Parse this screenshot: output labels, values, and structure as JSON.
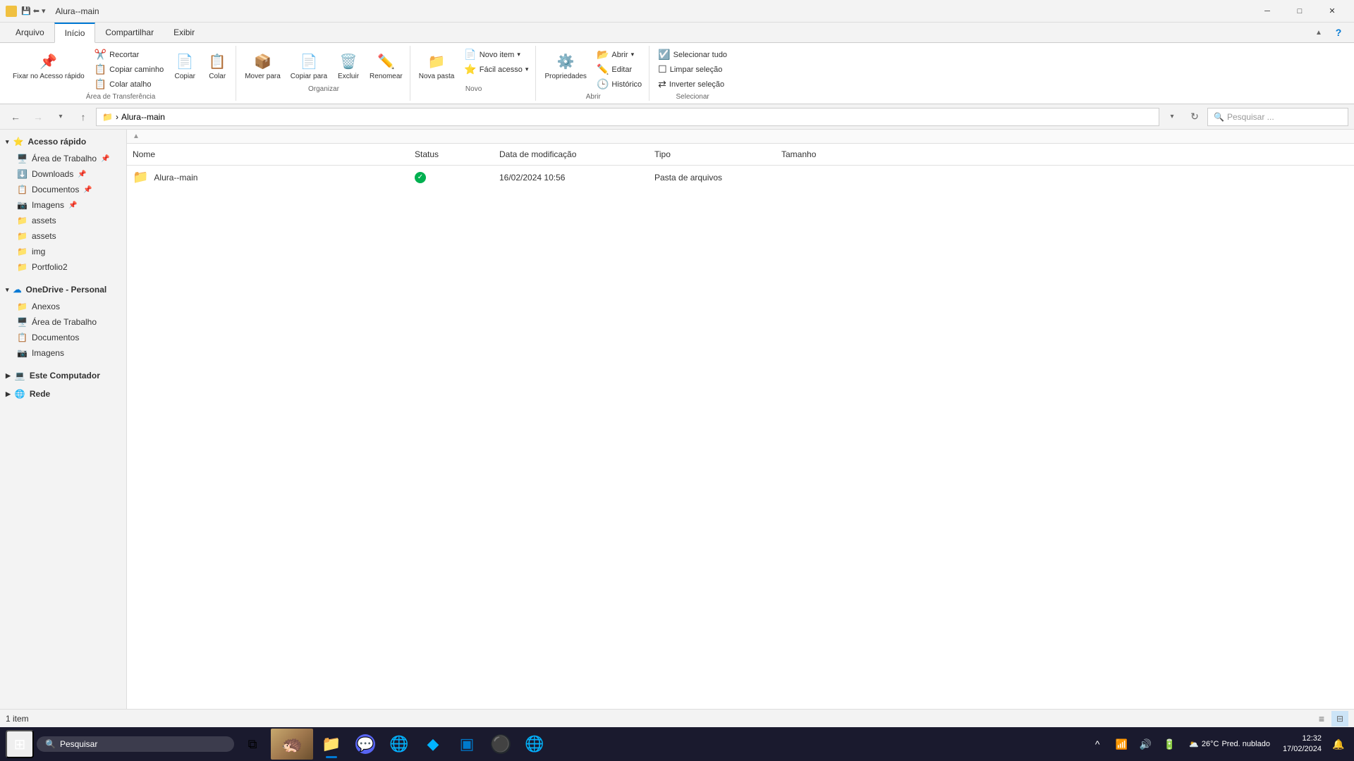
{
  "window": {
    "title": "Alura--main",
    "icon": "folder"
  },
  "title_bar": {
    "title": "Alura--main",
    "minimize_label": "─",
    "maximize_label": "□",
    "close_label": "✕"
  },
  "ribbon": {
    "tabs": [
      "Arquivo",
      "Início",
      "Compartilhar",
      "Exibir"
    ],
    "active_tab": "Início",
    "groups": {
      "area_transferencia": {
        "label": "Área de Transferência",
        "buttons": {
          "fixar": "Fixar no\nAcesso rápido",
          "copiar": "Copiar",
          "colar": "Colar",
          "recortar": "Recortar",
          "copiar_caminho": "Copiar caminho",
          "colar_atalho": "Colar atalho"
        }
      },
      "organizar": {
        "label": "Organizar",
        "buttons": {
          "mover": "Mover\npara",
          "copiar": "Copiar\npara",
          "excluir": "Excluir",
          "renomear": "Renomear"
        }
      },
      "novo": {
        "label": "Novo",
        "buttons": {
          "nova_pasta": "Nova\npasta",
          "novo_item": "Novo item",
          "facil_acesso": "Fácil acesso"
        }
      },
      "abrir": {
        "label": "Abrir",
        "buttons": {
          "abrir": "Abrir",
          "editar": "Editar",
          "historico": "Histórico",
          "propriedades": "Propriedades"
        }
      },
      "selecionar": {
        "label": "Selecionar",
        "buttons": {
          "selecionar_tudo": "Selecionar tudo",
          "limpar_selecao": "Limpar seleção",
          "inverter_selecao": "Inverter seleção"
        }
      }
    }
  },
  "address_bar": {
    "back_disabled": false,
    "forward_disabled": true,
    "up_disabled": false,
    "path_icon": "📁",
    "path": "Alura--main",
    "search_placeholder": "Pesquisar ..."
  },
  "sidebar": {
    "sections": [
      {
        "id": "acesso_rapido",
        "label": "Acesso rápido",
        "icon": "⭐",
        "items": [
          {
            "id": "area_de_trabalho",
            "label": "Área de Trabalho",
            "icon": "🖥️",
            "pinned": true
          },
          {
            "id": "downloads",
            "label": "Downloads",
            "icon": "⬇️",
            "pinned": true
          },
          {
            "id": "documentos",
            "label": "Documentos",
            "icon": "📋",
            "pinned": true
          },
          {
            "id": "imagens",
            "label": "Imagens",
            "icon": "📷",
            "pinned": true
          },
          {
            "id": "assets1",
            "label": "assets",
            "icon": "📁",
            "pinned": false
          },
          {
            "id": "assets2",
            "label": "assets",
            "icon": "📁",
            "pinned": false
          },
          {
            "id": "img",
            "label": "img",
            "icon": "📁",
            "pinned": false
          },
          {
            "id": "portfolio2",
            "label": "Portfolio2",
            "icon": "📁",
            "pinned": false
          }
        ]
      },
      {
        "id": "onedrive",
        "label": "OneDrive - Personal",
        "icon": "☁️",
        "items": [
          {
            "id": "anexos",
            "label": "Anexos",
            "icon": "📁"
          },
          {
            "id": "area_trabalho2",
            "label": "Área de Trabalho",
            "icon": "🖥️"
          },
          {
            "id": "documentos2",
            "label": "Documentos",
            "icon": "📋"
          },
          {
            "id": "imagens2",
            "label": "Imagens",
            "icon": "📷"
          }
        ]
      },
      {
        "id": "este_computador",
        "label": "Este Computador",
        "icon": "💻"
      },
      {
        "id": "rede",
        "label": "Rede",
        "icon": "🌐"
      }
    ]
  },
  "file_list": {
    "columns": {
      "name": "Nome",
      "status": "Status",
      "date": "Data de modificação",
      "type": "Tipo",
      "size": "Tamanho"
    },
    "files": [
      {
        "name": "Alura--main",
        "icon": "📁",
        "status_icon": "✓",
        "status_color": "#00b050",
        "date": "16/02/2024 10:56",
        "type": "Pasta de arquivos",
        "size": ""
      }
    ]
  },
  "status_bar": {
    "item_count": "1 item",
    "view_list_label": "☰",
    "view_details_label": "⊟"
  },
  "taskbar": {
    "start_icon": "⊞",
    "search_placeholder": "Pesquisar",
    "apps": [
      {
        "id": "task-view",
        "icon": "⧉",
        "active": false
      },
      {
        "id": "file-explorer",
        "icon": "📁",
        "active": true
      },
      {
        "id": "discord",
        "icon": "💬",
        "active": false,
        "color": "#5865F2"
      },
      {
        "id": "chrome",
        "icon": "🌐",
        "active": false
      },
      {
        "id": "unknown",
        "icon": "🔷",
        "active": false
      },
      {
        "id": "vscode",
        "icon": "📝",
        "active": false,
        "color": "#007ACC"
      },
      {
        "id": "github",
        "icon": "⚫",
        "active": false
      },
      {
        "id": "chrome2",
        "icon": "🌐",
        "active": false
      }
    ],
    "system_tray": {
      "chevron": "^",
      "wifi_icon": "📶",
      "sound_icon": "🔊",
      "battery_icon": "🔋"
    },
    "weather": {
      "icon": "🌥️",
      "temp": "26°C",
      "desc": "Pred. nublado"
    },
    "clock": {
      "time": "12:32",
      "date": "17/02/2024"
    },
    "notification_icon": "🔔",
    "thumbnail_preview": true
  }
}
